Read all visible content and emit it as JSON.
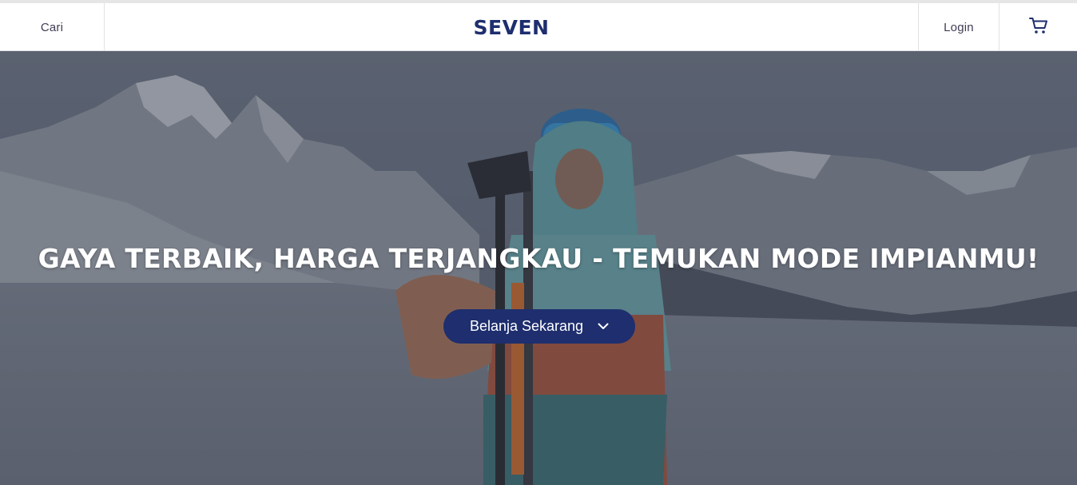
{
  "header": {
    "search_label": "Cari",
    "logo_text": "SEVEN",
    "login_label": "Login",
    "cart_icon": "cart-icon"
  },
  "hero": {
    "headline": "GAYA TERBAIK, HARGA TERJANGKAU - TEMUKAN MODE IMPIANMU!",
    "cta_label": "Belanja Sekarang",
    "cta_icon": "chevron-down-icon"
  },
  "colors": {
    "brand_navy": "#1e2e6e",
    "header_bg": "#ffffff",
    "nav_text": "#3d3d55",
    "hero_overlay": "#5b6272"
  }
}
